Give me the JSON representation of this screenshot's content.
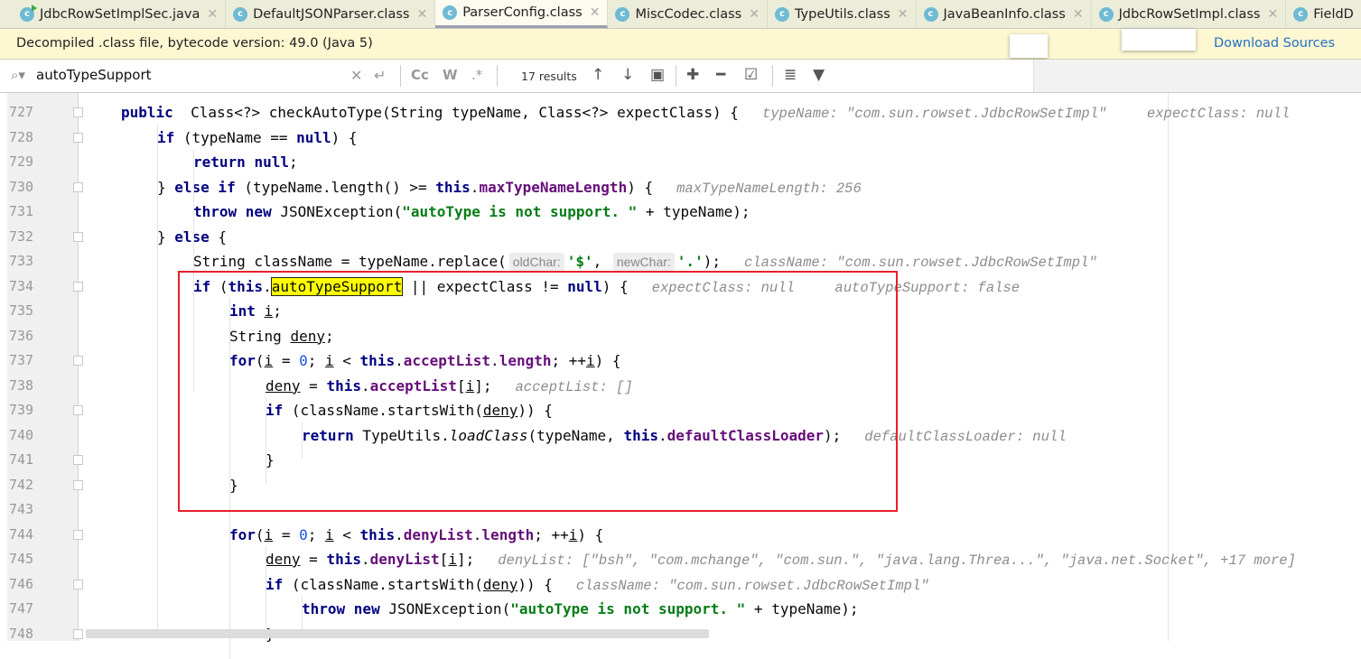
{
  "tabs": [
    {
      "label": "JdbcRowSetImplSec.java",
      "type": "java",
      "active": false
    },
    {
      "label": "DefaultJSONParser.class",
      "type": "class",
      "active": false
    },
    {
      "label": "ParserConfig.class",
      "type": "class",
      "active": true
    },
    {
      "label": "MiscCodec.class",
      "type": "class",
      "active": false
    },
    {
      "label": "TypeUtils.class",
      "type": "class",
      "active": false
    },
    {
      "label": "JavaBeanInfo.class",
      "type": "class",
      "active": false
    },
    {
      "label": "JdbcRowSetImpl.class",
      "type": "class",
      "active": false
    },
    {
      "label": "FieldD",
      "type": "class",
      "active": false
    }
  ],
  "banner": {
    "message": "Decompiled .class file, bytecode version: 49.0 (Java 5)",
    "download_label": "Download Sources"
  },
  "search": {
    "value": "autoTypeSupport",
    "results": "17 results",
    "match_case": "Cc",
    "words": "W",
    "regex": ".*"
  },
  "colors": {
    "highlight": "#ffff00",
    "annotation_box": "#e8202a",
    "keyword": "#000080",
    "field": "#660e7a",
    "string": "#067d17"
  },
  "code": [
    {
      "num": "727",
      "indent": 0,
      "fold": true,
      "tokens": [
        [
          "k",
          "public"
        ],
        [
          "",
          "  Class<?> checkAutoType(String typeName, Class<?> expectClass) {"
        ],
        [
          "h",
          "typeName: \"com.sun.rowset.JdbcRowSetImpl\""
        ],
        [
          "h",
          "  expectClass: null"
        ]
      ]
    },
    {
      "num": "728",
      "indent": 1,
      "fold": true,
      "tokens": [
        [
          "k",
          "if"
        ],
        [
          "",
          " (typeName == "
        ],
        [
          "k",
          "null"
        ],
        [
          "",
          ") {"
        ]
      ]
    },
    {
      "num": "729",
      "indent": 2,
      "fold": false,
      "tokens": [
        [
          "k",
          "return"
        ],
        [
          "",
          " "
        ],
        [
          "k",
          "null"
        ],
        [
          "",
          ";"
        ]
      ]
    },
    {
      "num": "730",
      "indent": 1,
      "fold": true,
      "tokens": [
        [
          "",
          "} "
        ],
        [
          "k",
          "else if"
        ],
        [
          "",
          " (typeName.length() >= "
        ],
        [
          "k",
          "this"
        ],
        [
          "",
          "."
        ],
        [
          "f",
          "maxTypeNameLength"
        ],
        [
          "",
          ") {"
        ],
        [
          "h",
          "maxTypeNameLength: 256"
        ]
      ]
    },
    {
      "num": "731",
      "indent": 2,
      "fold": false,
      "tokens": [
        [
          "k",
          "throw new"
        ],
        [
          "",
          " JSONException("
        ],
        [
          "s",
          "\"autoType is not support. \""
        ],
        [
          "",
          " + typeName);"
        ]
      ]
    },
    {
      "num": "732",
      "indent": 1,
      "fold": true,
      "tokens": [
        [
          "",
          "} "
        ],
        [
          "k",
          "else"
        ],
        [
          "",
          " {"
        ]
      ]
    },
    {
      "num": "733",
      "indent": 2,
      "fold": false,
      "tokens": [
        [
          "",
          "String className = typeName.replace("
        ],
        [
          "p",
          "oldChar:"
        ],
        [
          "s",
          "'$'"
        ],
        [
          "",
          ", "
        ],
        [
          "p",
          "newChar:"
        ],
        [
          "s",
          "'.'"
        ],
        [
          "",
          ");"
        ],
        [
          "h",
          "className: \"com.sun.rowset.JdbcRowSetImpl\""
        ]
      ]
    },
    {
      "num": "734",
      "indent": 2,
      "fold": true,
      "tokens": [
        [
          "k",
          "if"
        ],
        [
          "",
          " ("
        ],
        [
          "k",
          "this"
        ],
        [
          "",
          "."
        ],
        [
          "hl",
          "autoTypeSupport"
        ],
        [
          "",
          " || expectClass != "
        ],
        [
          "k",
          "null"
        ],
        [
          "",
          ") {"
        ],
        [
          "h",
          "expectClass: null"
        ],
        [
          "h",
          "  autoTypeSupport: false"
        ]
      ]
    },
    {
      "num": "735",
      "indent": 3,
      "fold": false,
      "tokens": [
        [
          "k",
          "int"
        ],
        [
          "",
          " "
        ],
        [
          "u",
          "i"
        ],
        [
          "",
          ";"
        ]
      ]
    },
    {
      "num": "736",
      "indent": 3,
      "fold": false,
      "tokens": [
        [
          "",
          "String "
        ],
        [
          "u",
          "deny"
        ],
        [
          "",
          ";"
        ]
      ]
    },
    {
      "num": "737",
      "indent": 3,
      "fold": true,
      "tokens": [
        [
          "k",
          "for"
        ],
        [
          "",
          "("
        ],
        [
          "u",
          "i"
        ],
        [
          "",
          " = "
        ],
        [
          "n",
          "0"
        ],
        [
          "",
          "; "
        ],
        [
          "u",
          "i"
        ],
        [
          "",
          " < "
        ],
        [
          "k",
          "this"
        ],
        [
          "",
          "."
        ],
        [
          "f",
          "acceptList"
        ],
        [
          "",
          "."
        ],
        [
          "f",
          "length"
        ],
        [
          "",
          "; ++"
        ],
        [
          "u",
          "i"
        ],
        [
          "",
          ") {"
        ]
      ]
    },
    {
      "num": "738",
      "indent": 4,
      "fold": false,
      "tokens": [
        [
          "u",
          "deny"
        ],
        [
          "",
          " = "
        ],
        [
          "k",
          "this"
        ],
        [
          "",
          "."
        ],
        [
          "f",
          "acceptList"
        ],
        [
          "",
          "["
        ],
        [
          "u",
          "i"
        ],
        [
          "",
          "];"
        ],
        [
          "h",
          "acceptList: []"
        ]
      ]
    },
    {
      "num": "739",
      "indent": 4,
      "fold": true,
      "tokens": [
        [
          "k",
          "if"
        ],
        [
          "",
          " (className.startsWith("
        ],
        [
          "u",
          "deny"
        ],
        [
          "",
          ")) {"
        ]
      ]
    },
    {
      "num": "740",
      "indent": 5,
      "fold": false,
      "tokens": [
        [
          "k",
          "return"
        ],
        [
          "",
          " TypeUtils."
        ],
        [
          "m",
          "loadClass"
        ],
        [
          "",
          "(typeName, "
        ],
        [
          "k",
          "this"
        ],
        [
          "",
          "."
        ],
        [
          "f",
          "defaultClassLoader"
        ],
        [
          "",
          ");"
        ],
        [
          "h",
          "defaultClassLoader: null"
        ]
      ]
    },
    {
      "num": "741",
      "indent": 4,
      "fold": true,
      "tokens": [
        [
          "",
          "}"
        ]
      ]
    },
    {
      "num": "742",
      "indent": 3,
      "fold": true,
      "tokens": [
        [
          "",
          "}"
        ]
      ]
    },
    {
      "num": "743",
      "indent": 0,
      "fold": false,
      "tokens": []
    },
    {
      "num": "744",
      "indent": 3,
      "fold": true,
      "tokens": [
        [
          "k",
          "for"
        ],
        [
          "",
          "("
        ],
        [
          "u",
          "i"
        ],
        [
          "",
          " = "
        ],
        [
          "n",
          "0"
        ],
        [
          "",
          "; "
        ],
        [
          "u",
          "i"
        ],
        [
          "",
          " < "
        ],
        [
          "k",
          "this"
        ],
        [
          "",
          "."
        ],
        [
          "f",
          "denyList"
        ],
        [
          "",
          "."
        ],
        [
          "f",
          "length"
        ],
        [
          "",
          "; ++"
        ],
        [
          "u",
          "i"
        ],
        [
          "",
          ") {"
        ]
      ]
    },
    {
      "num": "745",
      "indent": 4,
      "fold": false,
      "tokens": [
        [
          "u",
          "deny"
        ],
        [
          "",
          " = "
        ],
        [
          "k",
          "this"
        ],
        [
          "",
          "."
        ],
        [
          "f",
          "denyList"
        ],
        [
          "",
          "["
        ],
        [
          "u",
          "i"
        ],
        [
          "",
          "];"
        ],
        [
          "h",
          "denyList: [\"bsh\", \"com.mchange\", \"com.sun.\", \"java.lang.Threa...\", \"java.net.Socket\", +17 more]"
        ]
      ]
    },
    {
      "num": "746",
      "indent": 4,
      "fold": true,
      "tokens": [
        [
          "k",
          "if"
        ],
        [
          "",
          " (className.startsWith("
        ],
        [
          "u",
          "deny"
        ],
        [
          "",
          ")) {"
        ],
        [
          "h",
          "className: \"com.sun.rowset.JdbcRowSetImpl\""
        ]
      ]
    },
    {
      "num": "747",
      "indent": 5,
      "fold": false,
      "tokens": [
        [
          "k",
          "throw new"
        ],
        [
          "",
          " JSONException("
        ],
        [
          "s",
          "\"autoType is not support. \""
        ],
        [
          "",
          " + typeName);"
        ]
      ]
    },
    {
      "num": "748",
      "indent": 4,
      "fold": true,
      "tokens": [
        [
          "",
          "}"
        ]
      ]
    }
  ]
}
